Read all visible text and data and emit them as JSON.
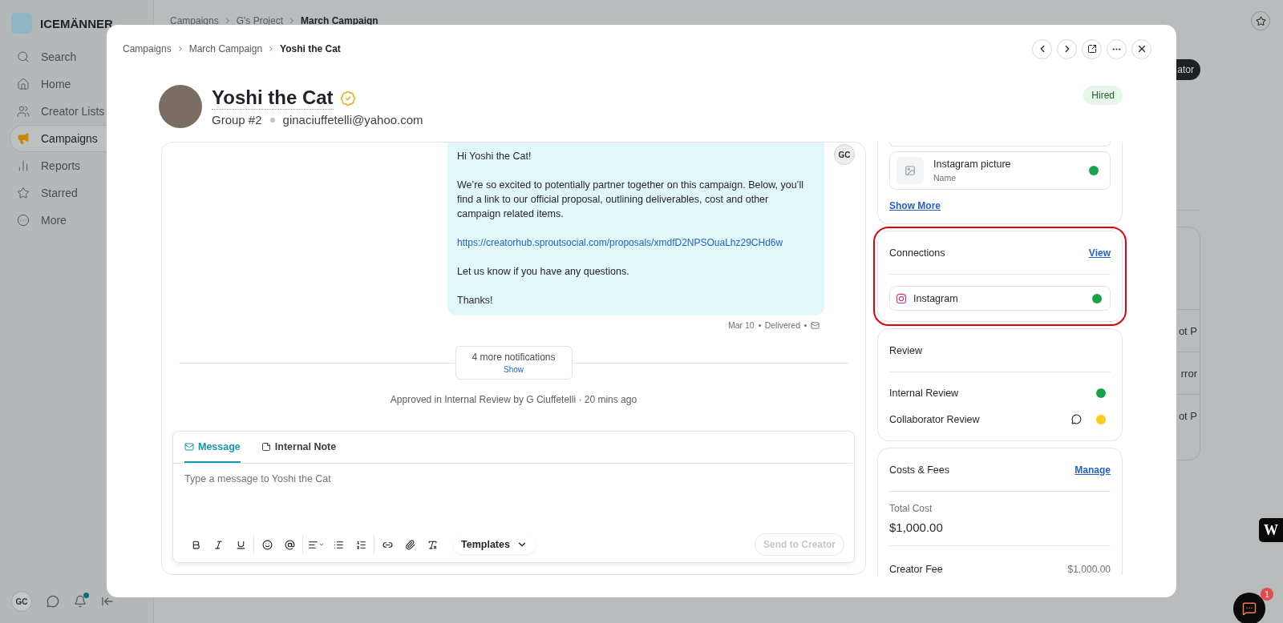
{
  "background": {
    "brand": "ICEMÄNNER",
    "nav": [
      {
        "label": "Search",
        "selected": false
      },
      {
        "label": "Home",
        "selected": false
      },
      {
        "label": "Creator Lists",
        "selected": false
      },
      {
        "label": "Campaigns",
        "selected": true
      },
      {
        "label": "Reports",
        "selected": false
      },
      {
        "label": "Starred",
        "selected": false
      },
      {
        "label": "More",
        "selected": false
      }
    ],
    "user_initials": "GC",
    "notifications_unread": true,
    "breadcrumbs": [
      "Campaigns",
      "G's Project",
      "March Campaign"
    ],
    "button_fragment": "ator",
    "table_fragments": [
      "ot P",
      "rror",
      "ot P"
    ],
    "widget_logo": "W",
    "chat_badge": "1"
  },
  "modal": {
    "breadcrumbs": [
      "Campaigns",
      "March Campaign",
      "Yoshi the Cat"
    ],
    "creator": {
      "name": "Yoshi the Cat",
      "verified": true,
      "group": "Group #2",
      "email": "ginaciuffetelli@yahoo.com",
      "status": "Hired"
    },
    "conversation": {
      "sender_initials": "GC",
      "message": [
        {
          "kind": "text",
          "text": "Hi Yoshi the Cat!"
        },
        {
          "kind": "text",
          "text": "We’re so excited to potentially partner together on this campaign. Below, you’ll find a link to our official proposal, outlining deliverables, cost and other campaign related items."
        },
        {
          "kind": "link",
          "text": "https://creatorhub.sproutsocial.com/proposals/xmdfD2NPSOuaLhz29CHd6w"
        },
        {
          "kind": "text",
          "text": "Let us know if you have any questions."
        },
        {
          "kind": "text",
          "text": "Thanks!"
        }
      ],
      "date": "Mar 10",
      "status": "Delivered",
      "notifications": {
        "label": "4 more notifications",
        "action": "Show"
      },
      "activity": "Approved in Internal Review by G Ciuffetelli · 20 mins ago"
    },
    "composer": {
      "tabs": [
        {
          "label": "Message",
          "selected": true
        },
        {
          "label": "Internal Note",
          "selected": false
        }
      ],
      "placeholder": "Type a message to Yoshi the Cat",
      "templates": "Templates",
      "send": "Send to Creator",
      "send_disabled": true
    },
    "deliverables": {
      "items": [
        {
          "title": "Instagram picture",
          "subtitle": "Name",
          "color": "#16a34a"
        }
      ],
      "more": "Show More"
    },
    "connections": {
      "title": "Connections",
      "action": "View",
      "highlighted": true,
      "items": [
        {
          "name": "Instagram",
          "color": "#16a34a"
        }
      ]
    },
    "review": {
      "title": "Review",
      "items": [
        {
          "label": "Internal Review",
          "comment": false,
          "color": "#16a34a"
        },
        {
          "label": "Collaborator Review",
          "comment": true,
          "color": "#facc15"
        }
      ]
    },
    "costs": {
      "title": "Costs & Fees",
      "action": "Manage",
      "total_label": "Total Cost",
      "total": "$1,000.00",
      "rows": [
        {
          "label": "Creator Fee",
          "value": "$1,000.00"
        }
      ]
    }
  }
}
